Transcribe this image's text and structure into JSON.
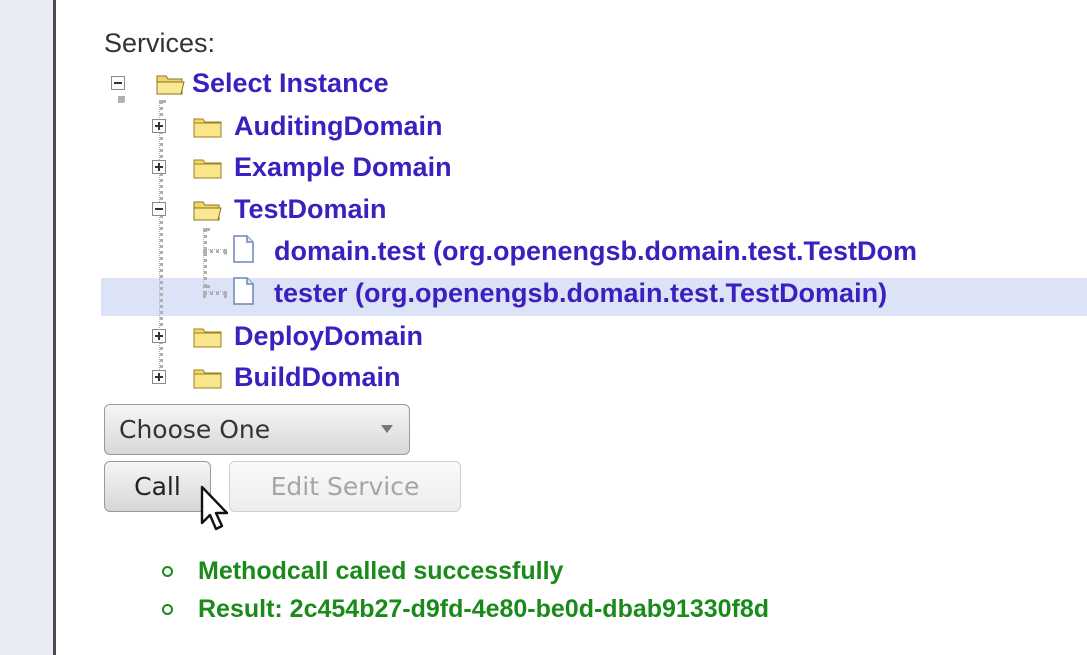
{
  "services_label": "Services:",
  "tree": {
    "root": {
      "label": "Select Instance",
      "expanded": true
    },
    "domains": [
      {
        "label": "AuditingDomain",
        "expanded": false
      },
      {
        "label": "Example Domain",
        "expanded": false
      },
      {
        "label": "TestDomain",
        "expanded": true,
        "children": [
          {
            "label": "domain.test (org.openengsb.domain.test.TestDom",
            "selected": false
          },
          {
            "label": "tester (org.openengsb.domain.test.TestDomain)",
            "selected": true
          }
        ]
      },
      {
        "label": "DeployDomain",
        "expanded": false
      },
      {
        "label": "BuildDomain",
        "expanded": false
      }
    ]
  },
  "method_select": {
    "value": "Choose One"
  },
  "buttons": {
    "call": "Call",
    "edit_service": "Edit Service"
  },
  "messages": [
    "Methodcall called successfully",
    "Result: 2c454b27-d9fd-4e80-be0d-dbab91330f8d"
  ],
  "colors": {
    "link": "#3b1fbf",
    "success": "#1a8a1a",
    "selection": "#dde3f6"
  },
  "icons": {
    "folder_open": "folder-open-icon",
    "folder_closed": "folder-icon",
    "file": "file-icon"
  }
}
